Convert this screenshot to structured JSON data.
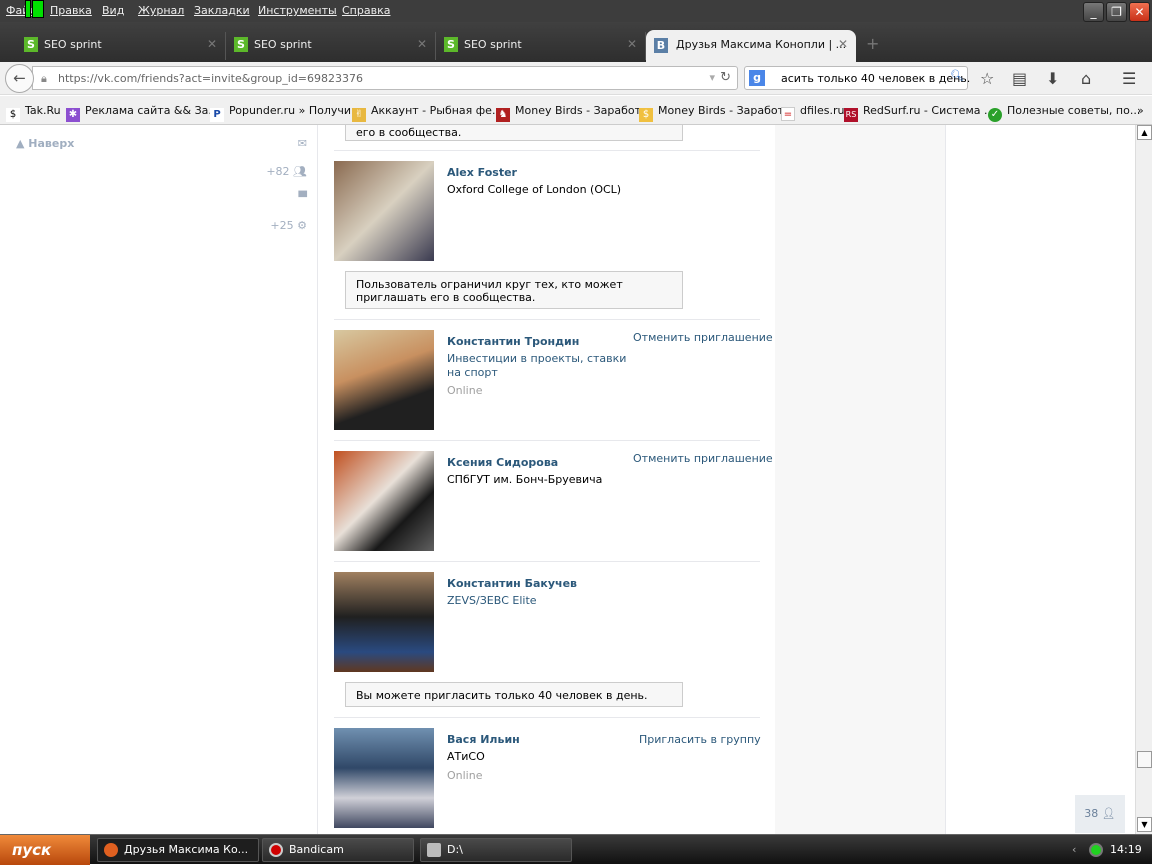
{
  "menu": [
    "Файл",
    "Правка",
    "Вид",
    "Журнал",
    "Закладки",
    "Инструменты",
    "Справка"
  ],
  "tabs": [
    {
      "label": "SEO sprint"
    },
    {
      "label": "SEO sprint"
    },
    {
      "label": "SEO sprint"
    },
    {
      "label": "Друзья Максима Конопли | ..."
    }
  ],
  "url": "https://vk.com/friends?act=invite&group_id=69823376",
  "search_value": "асить только 40 человек в день.",
  "bookmarks": [
    "Tak.Ru",
    "Реклама сайта && За...",
    "Popunder.ru » Получи...",
    "Аккаунт - Рыбная фе...",
    "Money Birds - Заработ...",
    "Money Birds - Заработ...",
    "dfiles.ru",
    "RedSurf.ru - Система ...",
    "Полезные советы, по..."
  ],
  "sidebar": {
    "top_label": "Наверх",
    "friends_count": "+82",
    "groups_count": "+25"
  },
  "partial_notice": "его в сообщества.",
  "people": [
    {
      "name": "Alex Foster",
      "subtitle": "Oxford College of London (OCL)",
      "notice": "Пользователь ограничил круг тех, кто может приглашать его в сообщества."
    },
    {
      "name": "Константин Трондин",
      "subtitle": "Инвестиции в проекты, ставки на спорт",
      "status": "Online",
      "action": "Отменить приглашение"
    },
    {
      "name": "Ксения Сидорова",
      "subtitle": "СПбГУТ им. Бонч-Бруевича",
      "action": "Отменить приглашение"
    },
    {
      "name": "Константин Бакучев",
      "subtitle": "ZEVS/ЗЕВС Elite",
      "notice": "Вы можете пригласить только 40 человек в день."
    },
    {
      "name": "Вася Ильин",
      "subtitle": "АТиСО",
      "status": "Online",
      "action": "Пригласить в группу"
    }
  ],
  "online_counter": "38",
  "taskbar": {
    "start": "пуск",
    "tasks": [
      "Друзья Максима Ко...",
      "Bandicam",
      "D:\\"
    ],
    "clock": "14:19"
  }
}
